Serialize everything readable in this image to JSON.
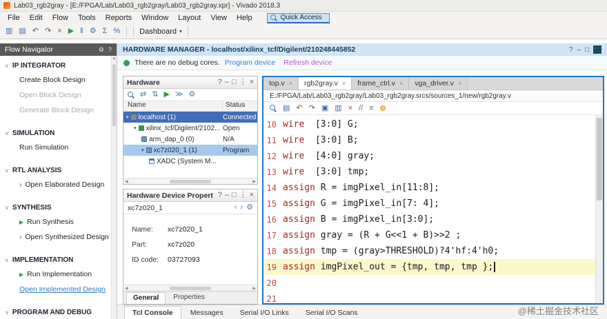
{
  "window": {
    "title": "Lab03_rgb2gray - [E:/FPGA/Lab/Lab03_rgb2gray/Lab03_rgb2gray.xpr] - Vivado 2018.3"
  },
  "menu": {
    "items": [
      "File",
      "Edit",
      "Flow",
      "Tools",
      "Reports",
      "Window",
      "Layout",
      "View",
      "Help"
    ],
    "quick_access": "Quick Access"
  },
  "toolbar": {
    "dashboard": "Dashboard",
    "icons": [
      {
        "name": "new-project",
        "glyph": "▥",
        "color": "#3a6ea8"
      },
      {
        "name": "save",
        "glyph": "▤",
        "color": "#3a6ea8"
      },
      {
        "name": "undo",
        "glyph": "↶",
        "color": "#5a5a5a"
      },
      {
        "name": "redo",
        "glyph": "↷",
        "color": "#5a5a5a"
      },
      {
        "name": "close-red",
        "glyph": "×",
        "color": "#c0392b"
      },
      {
        "name": "run",
        "glyph": "▶",
        "color": "#2e9e44"
      },
      {
        "name": "pause",
        "glyph": "‖",
        "color": "#3a6ea8"
      },
      {
        "name": "settings",
        "glyph": "⚙",
        "color": "#3a6ea8"
      },
      {
        "name": "sigma",
        "glyph": "Σ",
        "color": "#3a6ea8"
      },
      {
        "name": "report",
        "glyph": "%",
        "color": "#3a6ea8"
      }
    ]
  },
  "glyphs": {
    "expander": "▾",
    "section_collapse": "∨",
    "chevron": "›",
    "play": "▶",
    "left_arrow": "◀",
    "right_arrow": "▶",
    "dropdown": "▾"
  },
  "panel_controls": [
    {
      "name": "help",
      "glyph": "?"
    },
    {
      "name": "minimize",
      "glyph": "–"
    },
    {
      "name": "float",
      "glyph": "□"
    },
    {
      "name": "menu",
      "glyph": "⋮"
    },
    {
      "name": "close",
      "glyph": "×"
    }
  ],
  "flow_navigator": {
    "title": "Flow Navigator",
    "sections": [
      {
        "label": "IP INTEGRATOR",
        "items": [
          {
            "label": "Create Block Design",
            "style": "normal"
          },
          {
            "label": "Open Block Design",
            "style": "disabled"
          },
          {
            "label": "Generate Block Design",
            "style": "disabled"
          }
        ]
      },
      {
        "label": "SIMULATION",
        "items": [
          {
            "label": "Run Simulation",
            "style": "normal"
          }
        ]
      },
      {
        "label": "RTL ANALYSIS",
        "items": [
          {
            "label": "Open Elaborated Design",
            "style": "normal",
            "chevron": true
          }
        ]
      },
      {
        "label": "SYNTHESIS",
        "items": [
          {
            "label": "Run Synthesis",
            "style": "normal",
            "play": true
          },
          {
            "label": "Open Synthesized Design",
            "style": "normal",
            "chevron": true
          }
        ]
      },
      {
        "label": "IMPLEMENTATION",
        "items": [
          {
            "label": "Run Implementation",
            "style": "normal",
            "play": true
          },
          {
            "label": "Open Implemented Design",
            "style": "link"
          }
        ]
      },
      {
        "label": "PROGRAM AND DEBUG",
        "items": []
      }
    ]
  },
  "hardware_manager": {
    "title": "HARDWARE MANAGER - localhost/xilinx_tcf/Digilent/210248445852",
    "info_text": "There are no debug cores.",
    "links": [
      "Program device",
      "Refresh device"
    ]
  },
  "hardware_panel": {
    "title": "Hardware",
    "columns": [
      "Name",
      "Status"
    ],
    "toolbar_icons": [
      {
        "name": "search",
        "glyph": "mag"
      },
      {
        "name": "reconnect",
        "glyph": "⇄",
        "color": "#4a7fb5"
      },
      {
        "name": "refresh",
        "glyph": "⇅",
        "color": "#4a7fb5"
      },
      {
        "name": "run",
        "glyph": "▶",
        "color": "#2e9e44"
      },
      {
        "name": "step",
        "glyph": "≫",
        "color": "#4a7fb5"
      },
      {
        "name": "settings",
        "glyph": "⚙",
        "color": "#4a7fb5"
      }
    ],
    "rows": [
      {
        "name": "localhost (1)",
        "status": "Connected",
        "level": 0,
        "selected": "dark",
        "icon": "host",
        "expand": true
      },
      {
        "name": "xilinx_tcf/Digilent/2102...",
        "status": "Open",
        "level": 1,
        "selected": "",
        "icon": "board",
        "expand": true
      },
      {
        "name": "arm_dap_0 (0)",
        "status": "N/A",
        "level": 2,
        "selected": "",
        "icon": "chip",
        "expand": false
      },
      {
        "name": "xc7z020_1 (1)",
        "status": "Program",
        "level": 2,
        "selected": "light",
        "icon": "chip",
        "expand": true
      },
      {
        "name": "XADC (System M...",
        "status": "",
        "level": 3,
        "selected": "",
        "icon": "doc",
        "expand": false
      }
    ]
  },
  "device_properties": {
    "title": "Hardware Device Propert",
    "device": "xc7z020_1",
    "subbar_icons": [
      {
        "name": "back",
        "glyph": "‹",
        "color": "#4a7fb5"
      },
      {
        "name": "forward",
        "glyph": "›",
        "color": "#4a7fb5"
      },
      {
        "name": "settings",
        "glyph": "⚙",
        "color": "#4a7fb5"
      }
    ],
    "fields": [
      {
        "label": "Name:",
        "value": "xc7z020_1"
      },
      {
        "label": "Part:",
        "value": "xc7z020"
      },
      {
        "label": "ID code:",
        "value": "03727093"
      }
    ],
    "tabs": [
      {
        "label": "General",
        "active": true
      },
      {
        "label": "Properties",
        "active": false
      }
    ]
  },
  "editor": {
    "tabs": [
      {
        "label": "top.v",
        "active": false
      },
      {
        "label": "rgb2gray.v",
        "active": true
      },
      {
        "label": "frame_ctrl.v",
        "active": false
      },
      {
        "label": "vga_driver.v",
        "active": false
      }
    ],
    "path": "E:/FPGA/Lab/Lab03_rgb2gray/Lab03_rgb2gray.srcs/sources_1/new/rgb2gray.v",
    "toolbar_icons": [
      {
        "name": "search",
        "glyph": "mag"
      },
      {
        "name": "save",
        "glyph": "▤",
        "color": "#3a6ea8"
      },
      {
        "name": "undo",
        "glyph": "↶",
        "color": "#5a5a5a"
      },
      {
        "name": "redo",
        "glyph": "↷",
        "color": "#5a5a5a"
      },
      {
        "name": "cut",
        "glyph": "▣",
        "color": "#3a6ea8"
      },
      {
        "name": "copy",
        "glyph": "▥",
        "color": "#3a6ea8"
      },
      {
        "name": "delete",
        "glyph": "×",
        "color": "#c0392b"
      },
      {
        "name": "comment",
        "glyph": "//",
        "color": "#3a6ea8"
      },
      {
        "name": "toggle-lines",
        "glyph": "≡",
        "color": "#3a6ea8"
      },
      {
        "name": "lightbulb",
        "glyph": "bulb"
      }
    ],
    "lines": [
      {
        "num": 10,
        "kw": "wire",
        "code": "  [3:0] G;"
      },
      {
        "num": 11,
        "kw": "wire",
        "code": "  [3:0] B;"
      },
      {
        "num": 12,
        "kw": "wire",
        "code": "  [4:0] gray;"
      },
      {
        "num": 13,
        "kw": "wire",
        "code": "  [3:0] tmp;"
      },
      {
        "num": 14,
        "kw": "assign",
        "code": " R = imgPixel_in[11:8];"
      },
      {
        "num": 15,
        "kw": "assign",
        "code": " G = imgPixel_in[7: 4];"
      },
      {
        "num": 16,
        "kw": "assign",
        "code": " B = imgPixel_in[3:0];"
      },
      {
        "num": 17,
        "kw": "assign",
        "code": " gray = (R + G<<1 + B)>>2 ;"
      },
      {
        "num": 18,
        "kw": "assign",
        "code": " tmp = (gray>THRESHOLD)?4'hf:4'h0;"
      },
      {
        "num": 19,
        "kw": "assign",
        "code": " imgPixel_out = {tmp, tmp, tmp };",
        "highlight": true,
        "cursor": true
      },
      {
        "num": 20,
        "kw": "",
        "code": ""
      },
      {
        "num": 21,
        "kw": "",
        "code": ""
      }
    ]
  },
  "console": {
    "tabs": [
      {
        "label": "Tcl Console",
        "active": true
      },
      {
        "label": "Messages",
        "active": false
      },
      {
        "label": "Serial I/O Links",
        "active": false
      },
      {
        "label": "Serial I/O Scans",
        "active": false
      }
    ]
  },
  "watermark": "@稀土掘金技术社区"
}
